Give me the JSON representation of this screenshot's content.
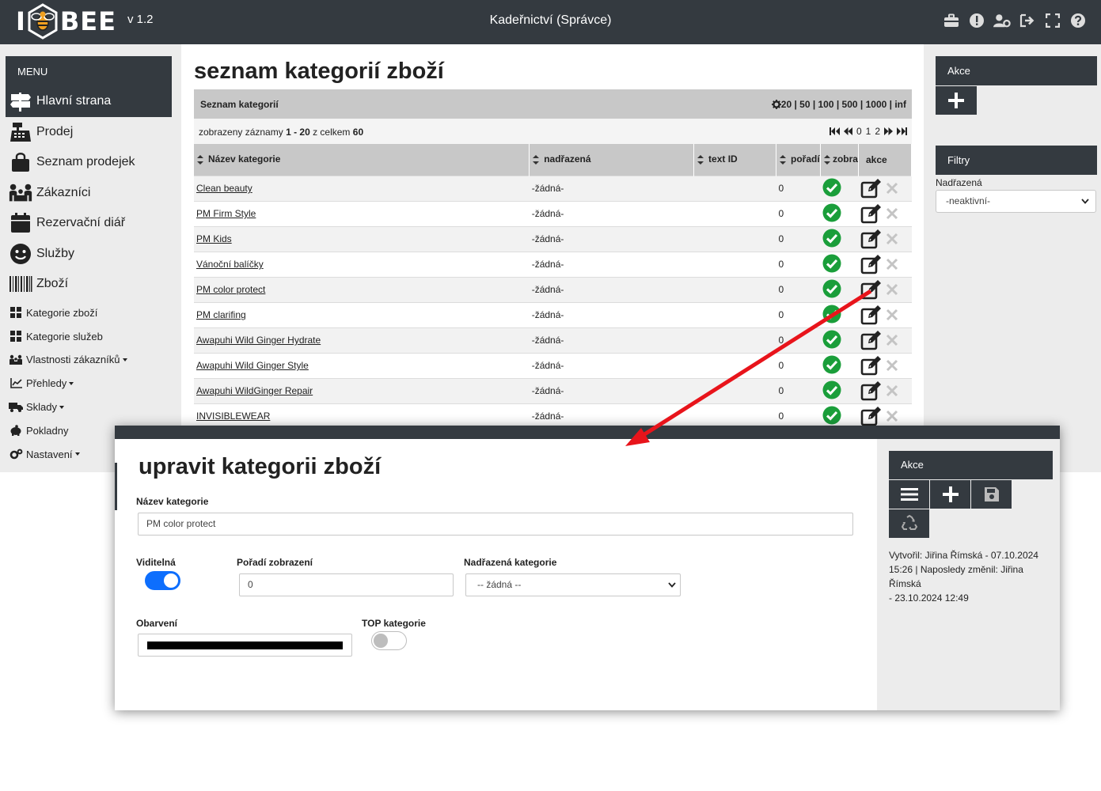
{
  "header": {
    "logo_text": "BEE",
    "logo_i": "I",
    "version": "v 1.2",
    "title": "Kadeřnictví (Správce)",
    "icons": [
      "briefcase-icon",
      "alert-icon",
      "user-cog-icon",
      "logout-icon",
      "fullscreen-icon",
      "help-icon"
    ]
  },
  "menu": {
    "title": "MENU",
    "big_items": [
      {
        "label": "Hlavní strana",
        "icon": "signpost-icon"
      },
      {
        "label": "Prodej",
        "icon": "cash-register-icon"
      },
      {
        "label": "Seznam prodejek",
        "icon": "shopping-bag-icon"
      },
      {
        "label": "Zákazníci",
        "icon": "people-icon"
      },
      {
        "label": "Rezervační diář",
        "icon": "calendar-icon"
      },
      {
        "label": "Služby",
        "icon": "smile-icon"
      },
      {
        "label": "Zboží",
        "icon": "barcode-icon"
      }
    ],
    "small_items": [
      {
        "label": "Kategorie zboží",
        "icon": "grid-icon"
      },
      {
        "label": "Kategorie služeb",
        "icon": "grid-icon"
      },
      {
        "label": "Vlastnosti zákazníků",
        "icon": "people-icon",
        "dropdown": true
      },
      {
        "label": "Přehledy",
        "icon": "chart-icon",
        "dropdown": true
      },
      {
        "label": "Sklady",
        "icon": "truck-icon",
        "dropdown": true
      },
      {
        "label": "Pokladny",
        "icon": "piggy-bank-icon",
        "dropdown": false
      },
      {
        "label": "Nastavení",
        "icon": "cogs-icon",
        "dropdown": true
      }
    ]
  },
  "list": {
    "page_title": "seznam kategorií zboží",
    "panel_title": "Seznam kategorií",
    "page_sizes": "20 | 50 | 100 | 500 | 1000 | inf",
    "records_prefix": "zobrazeny záznamy ",
    "records_range": "1 - 20",
    "records_mid": " z celkem ",
    "records_total": "60",
    "pages": [
      "0",
      "1",
      "2"
    ],
    "columns": [
      "Název kategorie",
      "nadřazená",
      "text ID",
      "pořadí",
      "zobraz",
      "akce"
    ],
    "rows": [
      {
        "name": "Clean beauty",
        "parent": "-žádná-",
        "text_id": "",
        "order": "0"
      },
      {
        "name": "PM Firm Style",
        "parent": "-žádná-",
        "text_id": "",
        "order": "0"
      },
      {
        "name": "PM Kids",
        "parent": "-žádná-",
        "text_id": "",
        "order": "0"
      },
      {
        "name": "Vánoční balíčky",
        "parent": "-žádná-",
        "text_id": "",
        "order": "0"
      },
      {
        "name": "PM color protect",
        "parent": "-žádná-",
        "text_id": "",
        "order": "0"
      },
      {
        "name": "PM clarifing",
        "parent": "-žádná-",
        "text_id": "",
        "order": "0"
      },
      {
        "name": "Awapuhi Wild Ginger Hydrate",
        "parent": "-žádná-",
        "text_id": "",
        "order": "0"
      },
      {
        "name": "Awapuhi Wild Ginger Style",
        "parent": "-žádná-",
        "text_id": "",
        "order": "0"
      },
      {
        "name": "Awapuhi WildGinger Repair",
        "parent": "-žádná-",
        "text_id": "",
        "order": "0"
      },
      {
        "name": "INVISIBLEWEAR",
        "parent": "-žádná-",
        "text_id": "",
        "order": "0"
      }
    ]
  },
  "right": {
    "actions_title": "Akce",
    "filters_title": "Filtry",
    "filter_label": "Nadřazená",
    "filter_value": "-neaktivní-"
  },
  "edit": {
    "title": "upravit kategorii zboží",
    "name_label": "Název kategorie",
    "name_value": "PM color protect",
    "visible_label": "Viditelná",
    "visible_on": true,
    "order_label": "Pořadí zobrazení",
    "order_value": "0",
    "parent_label": "Nadřazená kategorie",
    "parent_value": "-- žádná --",
    "color_label": "Obarvení",
    "color_value": "#000000",
    "top_label": "TOP kategorie",
    "top_on": false,
    "actions_title": "Akce",
    "meta_lines": [
      "Vytvořil: Jiřina Římská - 07.10.2024",
      "15:26 | Naposledy změnil: Jiřina Římská",
      "- 23.10.2024 12:49"
    ]
  },
  "colors": {
    "dark": "#343a40",
    "check_green": "#1a9e3a",
    "toggle_blue": "#0d6efd",
    "arrow_red": "#e8141b"
  }
}
